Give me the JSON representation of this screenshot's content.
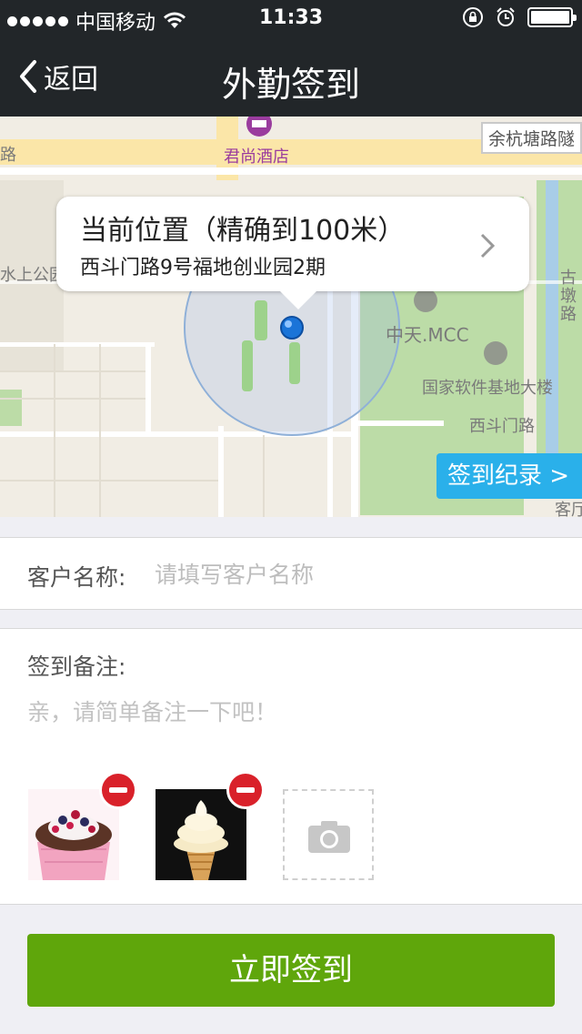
{
  "status_bar": {
    "carrier": "中国移动",
    "time": "11:33"
  },
  "nav": {
    "back_label": "返回",
    "title": "外勤签到"
  },
  "map": {
    "labels": {
      "hotel": "君尚酒店",
      "road_top_right": "余杭塘路隧",
      "road_left_top": "路",
      "water_left": "水上公园",
      "mcc": "中天.MCC",
      "software_base": "国家软件基地大楼",
      "xidoumen_road": "西斗门路",
      "vertical_road_right": "古墩路",
      "bottom_right": "客厅"
    },
    "bubble": {
      "title": "当前位置（精确到100米）",
      "address": "西斗门路9号福地创业园2期"
    },
    "records_button": "签到纪录 >"
  },
  "form": {
    "client_label": "客户名称:",
    "client_placeholder": "请填写客户名称",
    "notes_label": "签到备注:",
    "notes_placeholder": "亲，请简单备注一下吧！"
  },
  "submit_label": "立即签到",
  "colors": {
    "nav_bg": "#222629",
    "map_bg": "#f1ede4",
    "park_green": "#bcdca7",
    "records_blue": "#2ab0ea",
    "remove_red": "#d9212a",
    "submit_green": "#5fa60b"
  }
}
